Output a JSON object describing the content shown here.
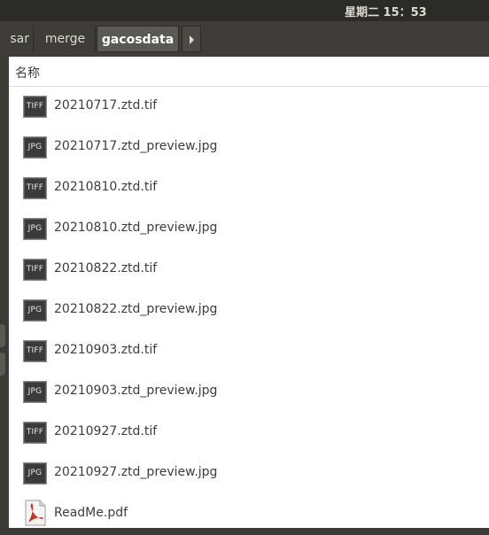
{
  "topbar": {
    "clock": "星期二 15：53"
  },
  "pathbar": {
    "crumbs": [
      {
        "label": "sar"
      },
      {
        "label": "merge"
      },
      {
        "label": "gacosdata"
      }
    ]
  },
  "column": {
    "name_header": "名称"
  },
  "files": [
    {
      "name": "20210717.ztd.tif",
      "type_label": "TIFF",
      "icon": "tiff-file-icon"
    },
    {
      "name": "20210717.ztd_preview.jpg",
      "type_label": "JPG",
      "icon": "jpg-file-icon"
    },
    {
      "name": "20210810.ztd.tif",
      "type_label": "TIFF",
      "icon": "tiff-file-icon"
    },
    {
      "name": "20210810.ztd_preview.jpg",
      "type_label": "JPG",
      "icon": "jpg-file-icon"
    },
    {
      "name": "20210822.ztd.tif",
      "type_label": "TIFF",
      "icon": "tiff-file-icon"
    },
    {
      "name": "20210822.ztd_preview.jpg",
      "type_label": "JPG",
      "icon": "jpg-file-icon"
    },
    {
      "name": "20210903.ztd.tif",
      "type_label": "TIFF",
      "icon": "tiff-file-icon"
    },
    {
      "name": "20210903.ztd_preview.jpg",
      "type_label": "JPG",
      "icon": "jpg-file-icon"
    },
    {
      "name": "20210927.ztd.tif",
      "type_label": "TIFF",
      "icon": "tiff-file-icon"
    },
    {
      "name": "20210927.ztd_preview.jpg",
      "type_label": "JPG",
      "icon": "jpg-file-icon"
    },
    {
      "name": "ReadMe.pdf",
      "type_label": "",
      "icon": "pdf-file-icon"
    }
  ],
  "colors": {
    "panel_dark": "#3c3b37",
    "active_crumb": "#5a5954",
    "pdf_red": "#c8322b"
  }
}
